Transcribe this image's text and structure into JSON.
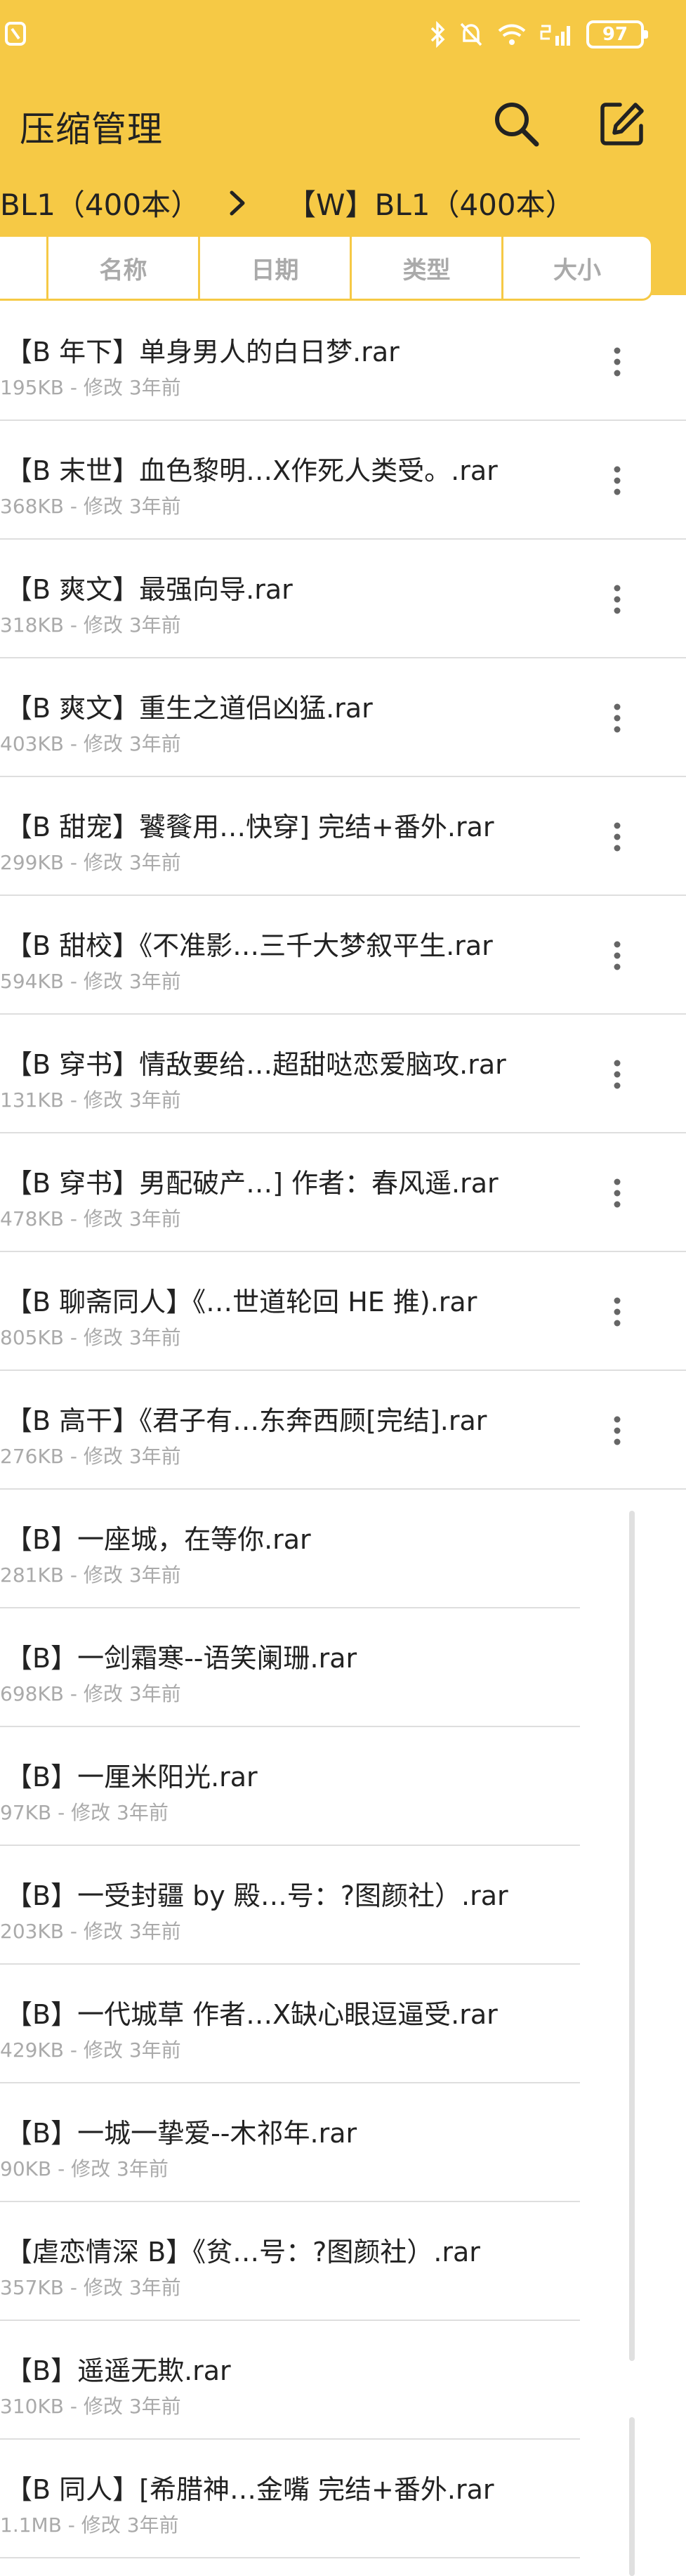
{
  "status": {
    "battery": "97"
  },
  "header": {
    "title": "压缩管理",
    "search_icon": "search-icon",
    "edit_icon": "edit-icon"
  },
  "breadcrumb": {
    "left": "BL1（400本）",
    "right": "【W】BL1（400本）"
  },
  "sort_tabs": [
    "",
    "名称",
    "日期",
    "类型",
    "大小"
  ],
  "files": [
    {
      "name": "【B 年下】单身男人的白日梦.rar",
      "meta": "195KB - 修改 3年前"
    },
    {
      "name": "【B 末世】血色黎明…X作死人类受。.rar",
      "meta": "368KB - 修改 3年前"
    },
    {
      "name": "【B 爽文】最强向导.rar",
      "meta": "318KB - 修改 3年前"
    },
    {
      "name": "【B 爽文】重生之道侣凶猛.rar",
      "meta": "403KB - 修改 3年前"
    },
    {
      "name": "【B 甜宠】饕餮用…快穿] 完结+番外.rar",
      "meta": "299KB - 修改 3年前"
    },
    {
      "name": "【B 甜校】《不准影…三千大梦叙平生.rar",
      "meta": "594KB - 修改 3年前"
    },
    {
      "name": "【B 穿书】情敌要给…超甜哒恋爱脑攻.rar",
      "meta": "131KB - 修改 3年前"
    },
    {
      "name": "【B 穿书】男配破产…] 作者：春风遥.rar",
      "meta": "478KB - 修改 3年前"
    },
    {
      "name": "【B 聊斋同人】《…世道轮回 HE 推).rar",
      "meta": "805KB - 修改 3年前"
    },
    {
      "name": "【B 高干】《君子有…东奔西顾[完结].rar",
      "meta": "276KB - 修改 3年前"
    },
    {
      "name": "【B】一座城，在等你.rar",
      "meta": "281KB - 修改 3年前"
    },
    {
      "name": "【B】一剑霜寒--语笑阑珊.rar",
      "meta": "698KB - 修改 3年前"
    },
    {
      "name": "【B】一厘米阳光.rar",
      "meta": "97KB - 修改 3年前"
    },
    {
      "name": "【B】一受封疆 by 殿…号：?图颜社）.rar",
      "meta": "203KB - 修改 3年前"
    },
    {
      "name": "【B】一代城草 作者…X缺心眼逗逼受.rar",
      "meta": "429KB - 修改 3年前"
    },
    {
      "name": "【B】一城一挚爱--木祁年.rar",
      "meta": "90KB - 修改 3年前"
    },
    {
      "name": "【虐恋情深 B】《贫…号：?图颜社）.rar",
      "meta": "357KB - 修改 3年前"
    },
    {
      "name": "【B】遥遥无欺.rar",
      "meta": "310KB - 修改 3年前"
    },
    {
      "name": "【B 同人】[希腊神…金嘴 完结+番外.rar",
      "meta": "1.1MB - 修改 3年前"
    }
  ]
}
